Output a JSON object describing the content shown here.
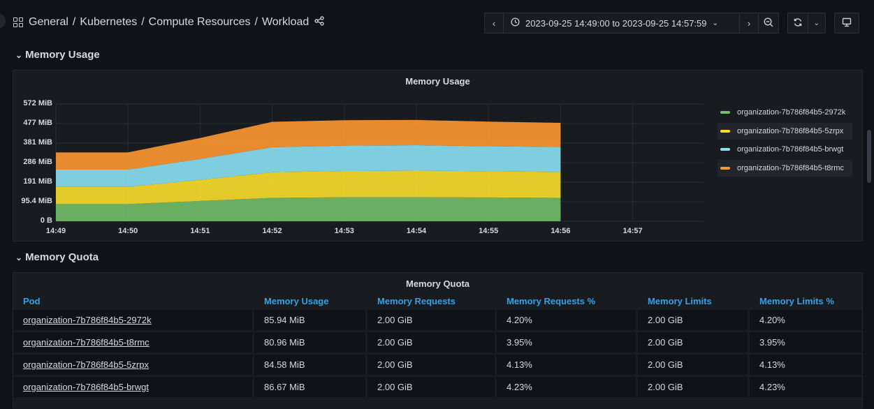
{
  "breadcrumb": {
    "items": [
      "General",
      "Kubernetes",
      "Compute Resources",
      "Workload"
    ],
    "separator": "/"
  },
  "toolbar": {
    "time_range": "2023-09-25 14:49:00 to 2023-09-25 14:57:59"
  },
  "rows": {
    "memory_usage": "Memory Usage",
    "memory_quota": "Memory Quota"
  },
  "usage_panel": {
    "title": "Memory Usage"
  },
  "quota_panel": {
    "title": "Memory Quota",
    "headers": [
      "Pod",
      "Memory Usage",
      "Memory Requests",
      "Memory Requests %",
      "Memory Limits",
      "Memory Limits %"
    ],
    "rows": [
      [
        "organization-7b786f84b5-2972k",
        "85.94 MiB",
        "2.00 GiB",
        "4.20%",
        "2.00 GiB",
        "4.20%"
      ],
      [
        "organization-7b786f84b5-t8rmc",
        "80.96 MiB",
        "2.00 GiB",
        "3.95%",
        "2.00 GiB",
        "3.95%"
      ],
      [
        "organization-7b786f84b5-5zrpx",
        "84.58 MiB",
        "2.00 GiB",
        "4.13%",
        "2.00 GiB",
        "4.13%"
      ],
      [
        "organization-7b786f84b5-brwgt",
        "86.67 MiB",
        "2.00 GiB",
        "4.23%",
        "2.00 GiB",
        "4.23%"
      ]
    ]
  },
  "chart_data": {
    "type": "area",
    "stacked": true,
    "title": "Memory Usage",
    "x": [
      "14:49",
      "14:50",
      "14:51",
      "14:52",
      "14:53",
      "14:54",
      "14:55",
      "14:56"
    ],
    "x_ticks": [
      "14:49",
      "14:50",
      "14:51",
      "14:52",
      "14:53",
      "14:54",
      "14:55",
      "14:56",
      "14:57"
    ],
    "y_ticks": [
      "0 B",
      "95.4 MiB",
      "191 MiB",
      "286 MiB",
      "381 MiB",
      "477 MiB",
      "572 MiB"
    ],
    "y_unit": "MiB",
    "ylim": [
      0,
      572
    ],
    "grid": true,
    "legend_position": "right",
    "series": [
      {
        "name": "organization-7b786f84b5-2972k",
        "color": "#73bf69",
        "values": [
          84,
          84,
          99,
          114,
          117,
          117,
          116,
          114
        ]
      },
      {
        "name": "organization-7b786f84b5-5zrpx",
        "color": "#fade2a",
        "values": [
          84,
          84,
          103,
          125,
          128,
          130,
          128,
          126
        ]
      },
      {
        "name": "organization-7b786f84b5-brwgt",
        "color": "#8ae2f5",
        "values": [
          84,
          84,
          102,
          122,
          124,
          124,
          122,
          122
        ]
      },
      {
        "name": "organization-7b786f84b5-t8rmc",
        "color": "#ff9830",
        "values": [
          84,
          84,
          102,
          124,
          124,
          123,
          120,
          118
        ]
      }
    ]
  }
}
